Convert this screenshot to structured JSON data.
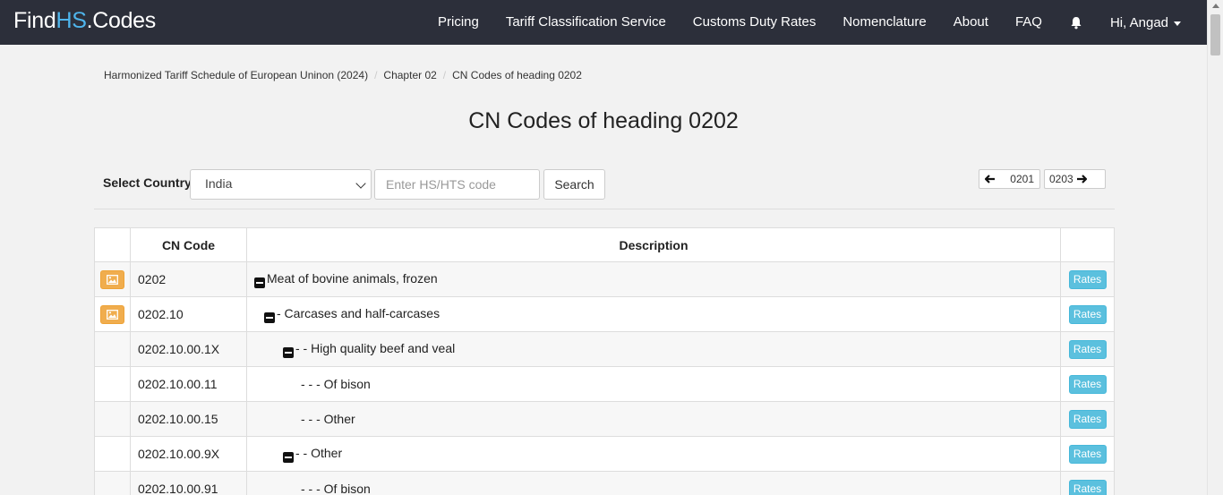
{
  "nav": {
    "brand_find": "Find",
    "brand_hs": "HS",
    "brand_codes": ".Codes",
    "links": [
      "Pricing",
      "Tariff Classification Service",
      "Customs Duty Rates",
      "Nomenclature",
      "About",
      "FAQ"
    ],
    "user": "Hi, Angad"
  },
  "breadcrumb": [
    "Harmonized Tariff Schedule of European Uninon (2024)",
    "Chapter 02",
    "CN Codes of heading 0202"
  ],
  "title": "CN Codes of heading 0202",
  "filter": {
    "label": "Select Country:",
    "country": "India",
    "input_placeholder": "Enter HS/HTS code",
    "search_label": "Search"
  },
  "pager": {
    "prev": "0201",
    "next": "0203"
  },
  "table": {
    "headers": [
      "",
      "CN Code",
      "Description",
      ""
    ],
    "rates_label": "Rates",
    "rows": [
      {
        "code": "0202",
        "desc": "Meat of bovine animals, frozen"
      },
      {
        "code": "0202.10",
        "desc": "- Carcases and half-carcases"
      },
      {
        "code": "0202.10.00.1X",
        "desc": "- - High quality beef and veal"
      },
      {
        "code": "0202.10.00.11",
        "desc": "- - - Of bison"
      },
      {
        "code": "0202.10.00.15",
        "desc": "- - - Other"
      },
      {
        "code": "0202.10.00.9X",
        "desc": "- - Other"
      },
      {
        "code": "0202.10.00.91",
        "desc": "- - - Of bison"
      }
    ]
  },
  "icons": {
    "bell": "bell-icon",
    "image": "image-icon",
    "collapse": "minus-square-icon",
    "arrow_left": "arrow-left-icon",
    "arrow_right": "arrow-right-icon"
  },
  "colors": {
    "navbar": "#2c2f3a",
    "brand_accent": "#4fb5ec",
    "image_button": "#f0ad4e",
    "rates_button": "#5bc0de"
  }
}
